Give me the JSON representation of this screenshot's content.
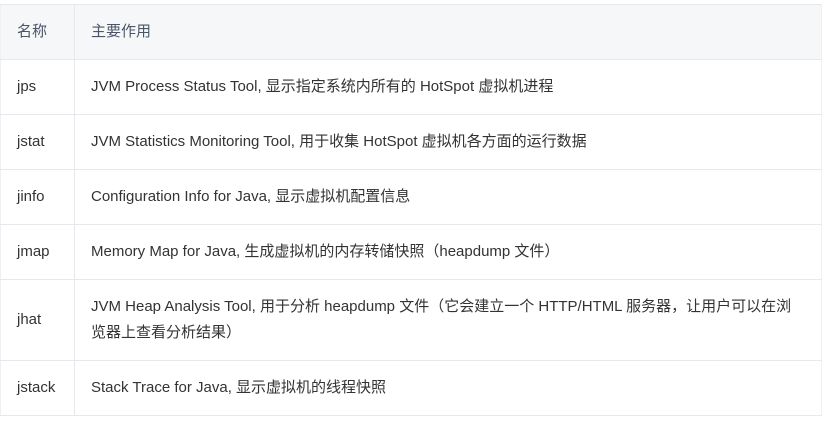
{
  "table": {
    "headers": {
      "name": "名称",
      "description": "主要作用"
    },
    "rows": [
      {
        "name": "jps",
        "description": "JVM Process Status Tool, 显示指定系统内所有的 HotSpot 虚拟机进程"
      },
      {
        "name": "jstat",
        "description": "JVM Statistics Monitoring Tool, 用于收集 HotSpot 虚拟机各方面的运行数据"
      },
      {
        "name": "jinfo",
        "description": "Configuration Info for Java, 显示虚拟机配置信息"
      },
      {
        "name": "jmap",
        "description": "Memory Map for Java, 生成虚拟机的内存转储快照（heapdump 文件）"
      },
      {
        "name": "jhat",
        "description": "JVM Heap Analysis Tool, 用于分析 heapdump 文件（它会建立一个 HTTP/HTML 服务器，让用户可以在浏览器上查看分析结果）"
      },
      {
        "name": "jstack",
        "description": "Stack Trace for Java, 显示虚拟机的线程快照"
      }
    ]
  }
}
